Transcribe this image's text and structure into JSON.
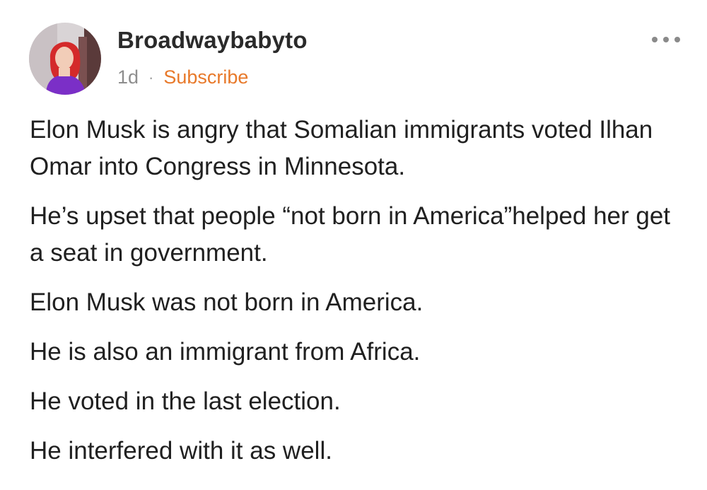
{
  "post": {
    "author": "Broadwaybabyto",
    "age": "1d",
    "separator": "·",
    "subscribe_label": "Subscribe",
    "more_icon": "more-horizontal-icon",
    "avatar_icon": "profile-avatar-image",
    "paragraphs": [
      "Elon Musk is angry that Somalian immigrants voted Ilhan Omar into Congress in Minnesota.",
      "He’s upset that people “not born in America”helped her get a seat in government.",
      "Elon Musk was not born in America.",
      "He is also an immigrant from Africa.",
      "He voted in the last election.",
      "He interfered with it as well."
    ]
  },
  "colors": {
    "subscribe": "#e8792a",
    "meta": "#8e8e8e",
    "text": "#202020"
  }
}
